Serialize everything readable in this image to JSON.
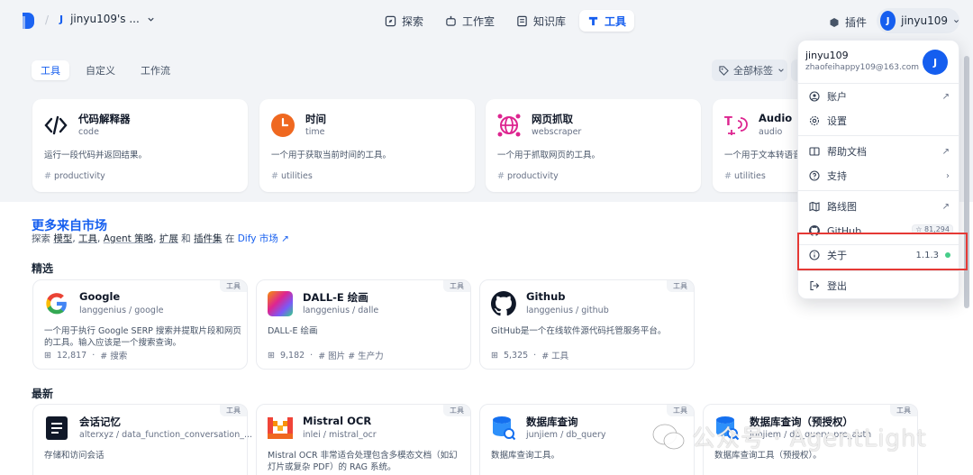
{
  "workspace": {
    "initial": "J",
    "name": "jinyu109's ..."
  },
  "nav": [
    {
      "label": "探索"
    },
    {
      "label": "工作室"
    },
    {
      "label": "知识库"
    },
    {
      "label": "工具"
    }
  ],
  "plugin_label": "插件",
  "user": {
    "initial": "J",
    "name": "jinyu109",
    "email": "zhaofeihappy109@163.com"
  },
  "tabs": [
    {
      "label": "工具"
    },
    {
      "label": "自定义"
    },
    {
      "label": "工作流"
    }
  ],
  "tag_filter": "全部标签",
  "tools": [
    {
      "name": "代码解释器",
      "sub": "code",
      "desc": "运行一段代码并返回结果。",
      "tag": "productivity",
      "icon": "code-icon"
    },
    {
      "name": "时间",
      "sub": "time",
      "desc": "一个用于获取当前时间的工具。",
      "tag": "utilities",
      "icon": "clock-icon"
    },
    {
      "name": "网页抓取",
      "sub": "webscraper",
      "desc": "一个用于抓取网页的工具。",
      "tag": "productivity",
      "icon": "web-icon"
    },
    {
      "name": "Audio",
      "sub": "audio",
      "desc": "一个用于文本转语音",
      "tag": "utilities",
      "icon": "audio-icon"
    }
  ],
  "market": {
    "title": "更多来自市场",
    "prefix": "探索",
    "k1": "模型",
    "k2": "工具",
    "k3": "Agent 策略",
    "k4": "扩展",
    "and": "和",
    "k5": "插件集",
    "in": "在",
    "link": "Dify 市场 ↗"
  },
  "featured_label": "精选",
  "latest_label": "最新",
  "badge": "工具",
  "featured": [
    {
      "name": "Google",
      "sub": "langgenius / google",
      "desc": "一个用于执行 Google SERP 搜索并提取片段和网页的工具。输入应该是一个搜索查询。",
      "count": "12,817",
      "tags": "# 搜索",
      "icon": "google-icon"
    },
    {
      "name": "DALL-E 绘画",
      "sub": "langgenius / dalle",
      "desc": "DALL-E 绘画",
      "count": "9,182",
      "tags": "# 图片 # 生产力",
      "icon": "dalle-icon"
    },
    {
      "name": "Github",
      "sub": "langgenius / github",
      "desc": "GitHub是一个在线软件源代码托管服务平台。",
      "count": "5,325",
      "tags": "# 工具",
      "icon": "github-icon"
    }
  ],
  "latest": [
    {
      "name": "会话记忆",
      "sub": "alterxyz / data_function_conversation_...",
      "desc": "存储和访问会话",
      "icon": "note-icon"
    },
    {
      "name": "Mistral OCR",
      "sub": "inlei / mistral_ocr",
      "desc": "Mistral OCR 非常适合处理包含多模态文档（如幻灯片或复杂 PDF）的 RAG 系统。",
      "icon": "mistral-icon"
    },
    {
      "name": "数据库查询",
      "sub": "junjiem / db_query",
      "desc": "数据库查询工具。",
      "icon": "database-icon"
    },
    {
      "name": "数据库查询（预授权）",
      "sub": "junjiem / db_query_pre_auth",
      "desc": "数据库查询工具（预授权）。",
      "icon": "database-icon"
    }
  ],
  "menu": {
    "account": "账户",
    "settings": "设置",
    "help": "帮助文档",
    "support": "支持",
    "roadmap": "路线图",
    "github": "GitHub",
    "stars": "☆ 81,294",
    "about": "关于",
    "version": "1.1.3",
    "logout": "登出"
  },
  "watermark": "公众号 · AgentLight"
}
